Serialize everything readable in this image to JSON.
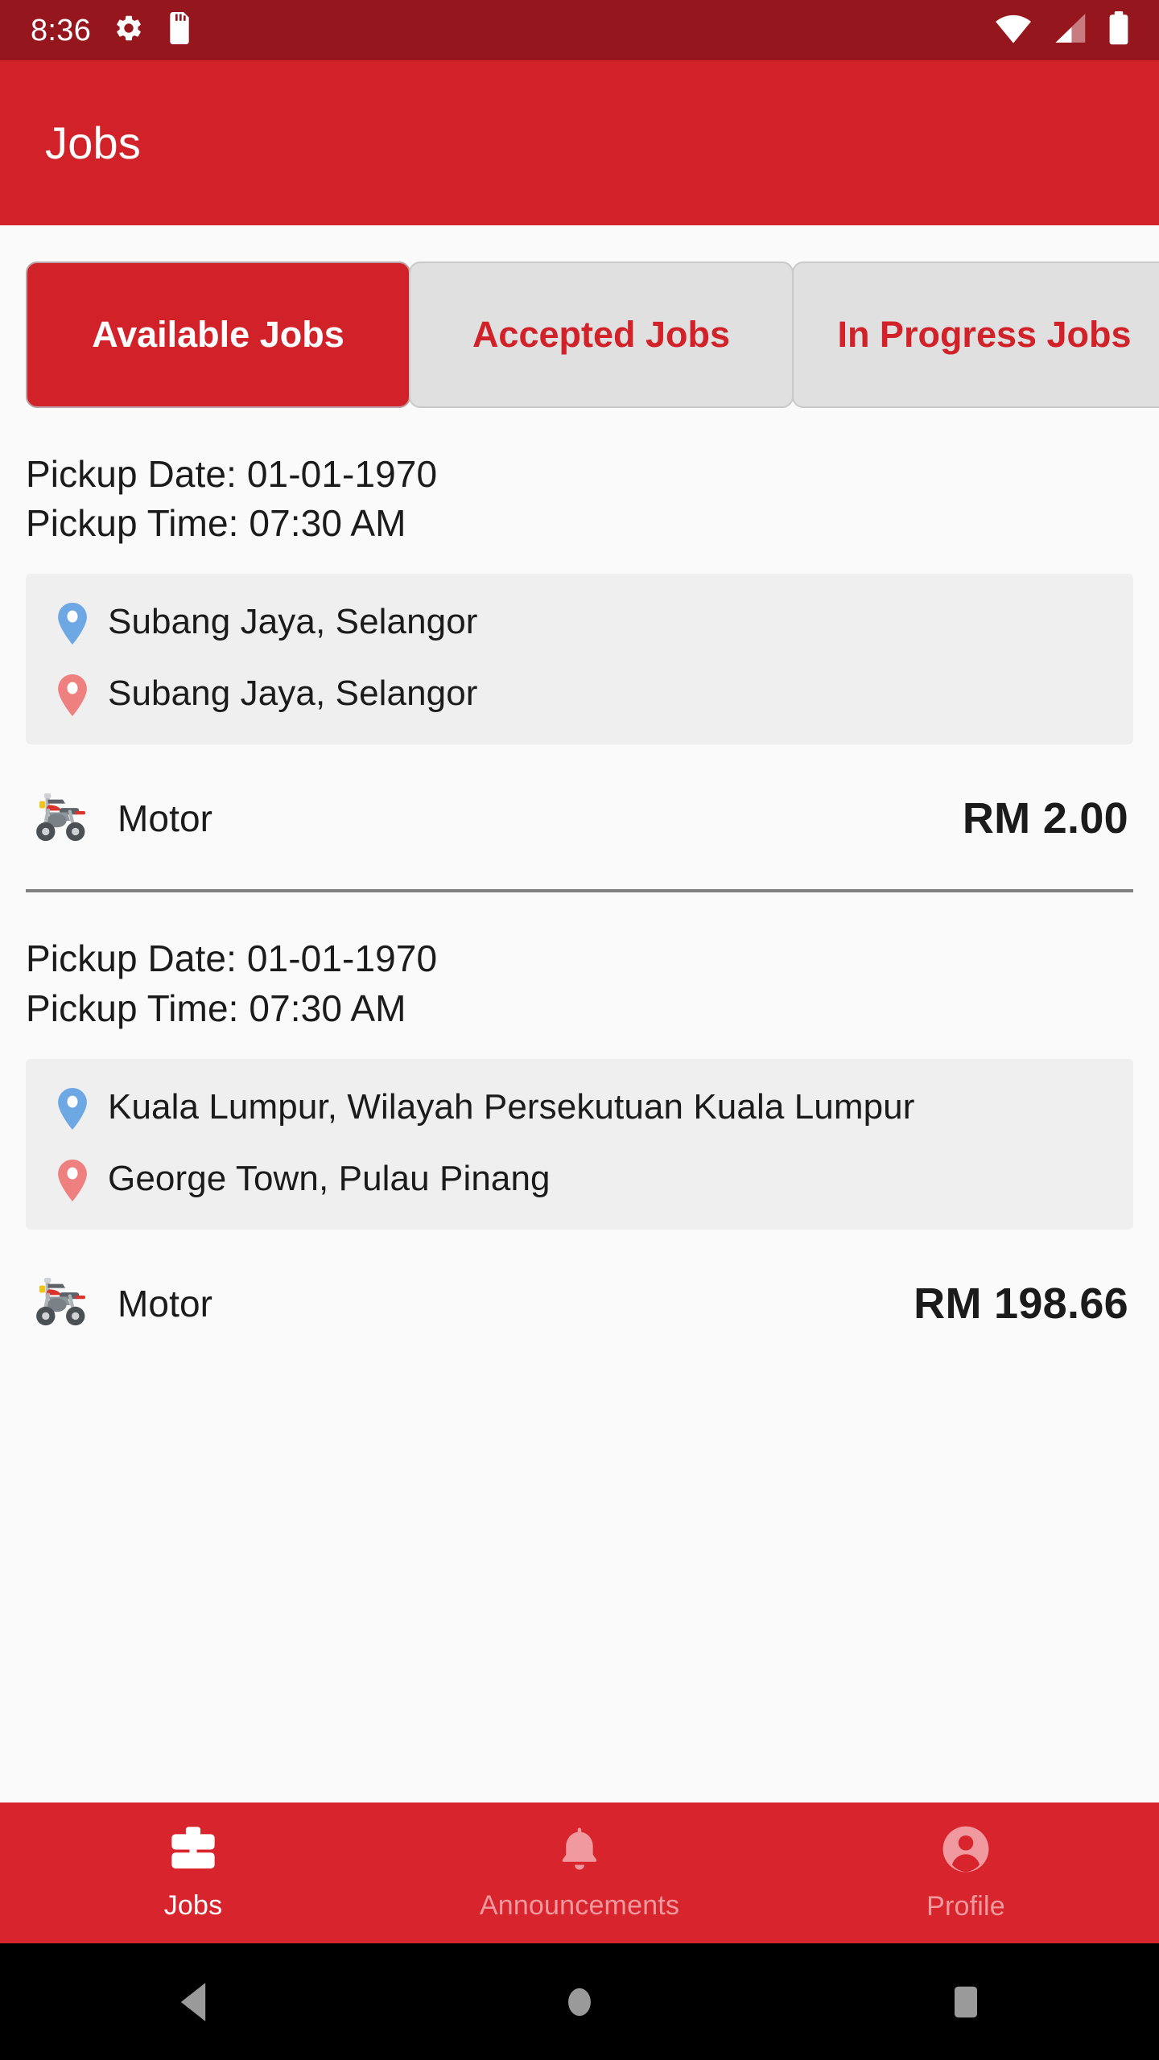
{
  "status_bar": {
    "clock": "8:36",
    "left_icons": [
      "gear-icon",
      "sd-card-icon"
    ],
    "right_icons": [
      "wifi-icon",
      "cellular-signal-icon",
      "battery-icon"
    ],
    "background_color": "#96161e"
  },
  "app_bar": {
    "title": "Jobs",
    "background_color": "#d12229"
  },
  "tabs": [
    {
      "label": "Available Jobs",
      "active": true
    },
    {
      "label": "Accepted Jobs",
      "active": false
    },
    {
      "label": "In Progress Jobs",
      "active": false
    }
  ],
  "jobs": [
    {
      "pickup_date_line": "Pickup Date: 01-01-1970",
      "pickup_time_line": "Pickup Time: 07:30 AM",
      "pickup_location": "Subang Jaya, Selangor",
      "dropoff_location": "Subang Jaya, Selangor",
      "vehicle": "Motor",
      "price": "RM 2.00"
    },
    {
      "pickup_date_line": "Pickup Date: 01-01-1970",
      "pickup_time_line": "Pickup Time: 07:30 AM",
      "pickup_location": "Kuala Lumpur, Wilayah Persekutuan Kuala Lumpur",
      "dropoff_location": "George Town, Pulau Pinang",
      "vehicle": "Motor",
      "price": "RM 198.66"
    }
  ],
  "bottom_nav": [
    {
      "label": "Jobs",
      "icon": "briefcase-icon",
      "active": true
    },
    {
      "label": "Announcements",
      "icon": "bell-icon",
      "active": false
    },
    {
      "label": "Profile",
      "icon": "person-icon",
      "active": false
    }
  ],
  "android_nav": {
    "back": "back-triangle-icon",
    "home": "home-circle-icon",
    "recents": "recents-square-icon"
  },
  "colors": {
    "brand_red": "#d12229",
    "status_bar_red": "#96161e",
    "bottom_nav_red": "#d8242c",
    "pickup_pin": "#6ea8e4",
    "dropoff_pin": "#ef8080",
    "loc_box_bg": "#efefef",
    "tab_inactive_bg": "#e0e0e0",
    "content_bg": "#fafafa"
  }
}
